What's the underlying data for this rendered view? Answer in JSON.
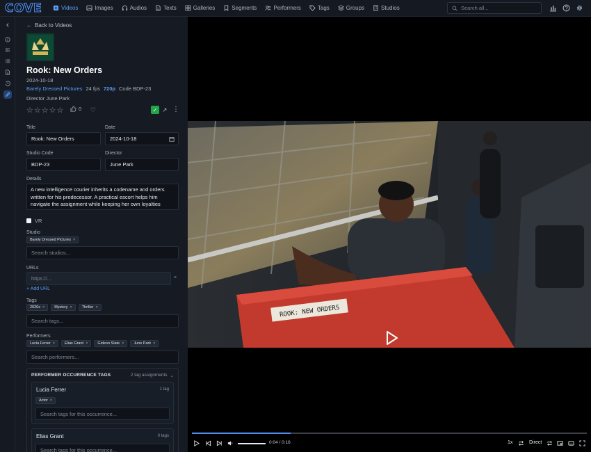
{
  "app": {
    "logo": "COVE"
  },
  "nav": {
    "items": [
      {
        "label": "Videos",
        "icon": "film-icon",
        "active": true
      },
      {
        "label": "Images",
        "icon": "image-icon"
      },
      {
        "label": "Audios",
        "icon": "headphones-icon"
      },
      {
        "label": "Texts",
        "icon": "document-icon"
      },
      {
        "label": "Galleries",
        "icon": "gallery-icon"
      },
      {
        "label": "Segments",
        "icon": "bookmark-icon"
      },
      {
        "label": "Performers",
        "icon": "users-icon"
      },
      {
        "label": "Tags",
        "icon": "tag-icon"
      },
      {
        "label": "Groups",
        "icon": "layers-icon"
      },
      {
        "label": "Studios",
        "icon": "building-icon"
      }
    ],
    "search_placeholder": "Search all..."
  },
  "panel": {
    "back_label": "Back to Videos",
    "title": "Rook: New Orders",
    "date": "2024-10-18",
    "studio": "Barely Dressed Pictures",
    "fps": "24 fps",
    "resolution": "720p",
    "code_label": "Code BDP-23",
    "director_label": "Director June Park",
    "likes": "0",
    "rating_stars": 0,
    "fields": {
      "title_label": "Title",
      "title_value": "Rook: New Orders",
      "date_label": "Date",
      "date_value": "2024-10-18",
      "studio_code_label": "Studio Code",
      "studio_code_value": "BDP-23",
      "director_label": "Director",
      "director_value": "June Park",
      "details_label": "Details",
      "details_value": "A new intelligence courier inherits a codename and orders written for his predecessor. A practical escort helps him navigate the assignment while keeping her own loyalties difficult to read.",
      "vr_label": "VR",
      "studio_label": "Studio",
      "studio_chip": "Barely Dressed Pictures",
      "studio_placeholder": "Search studios...",
      "urls_label": "URLs",
      "url_placeholder": "https://...",
      "add_url": "+ Add URL",
      "tags_label": "Tags",
      "tags": [
        "2020s",
        "Mystery",
        "Thriller"
      ],
      "tags_placeholder": "Search tags...",
      "performers_label": "Performers",
      "performers": [
        "Lucia Ferrer",
        "Elias Grant",
        "Gideon Slate",
        "June Park"
      ],
      "performers_placeholder": "Search performers..."
    },
    "occurrence": {
      "heading": "PERFORMER OCCURRENCE TAGS",
      "count": "2 tag assignments",
      "cards": [
        {
          "name": "Lucia Ferrer",
          "tag_count": "1 tag",
          "chip": "Actor",
          "placeholder": "Search tags for this occurrence..."
        },
        {
          "name": "Elias Grant",
          "tag_count": "0 tags",
          "placeholder": "Search tags for this occurrence..."
        }
      ]
    }
  },
  "video": {
    "luggage_label": "ROOK: NEW ORDERS",
    "progress_fraction": 0.25,
    "time": "0:04 / 0:16",
    "speed": "1x",
    "mode": "Direct"
  },
  "colors": {
    "accent": "#4f8df0",
    "confirm": "#23a44b",
    "luggage": "#c23a2e"
  }
}
